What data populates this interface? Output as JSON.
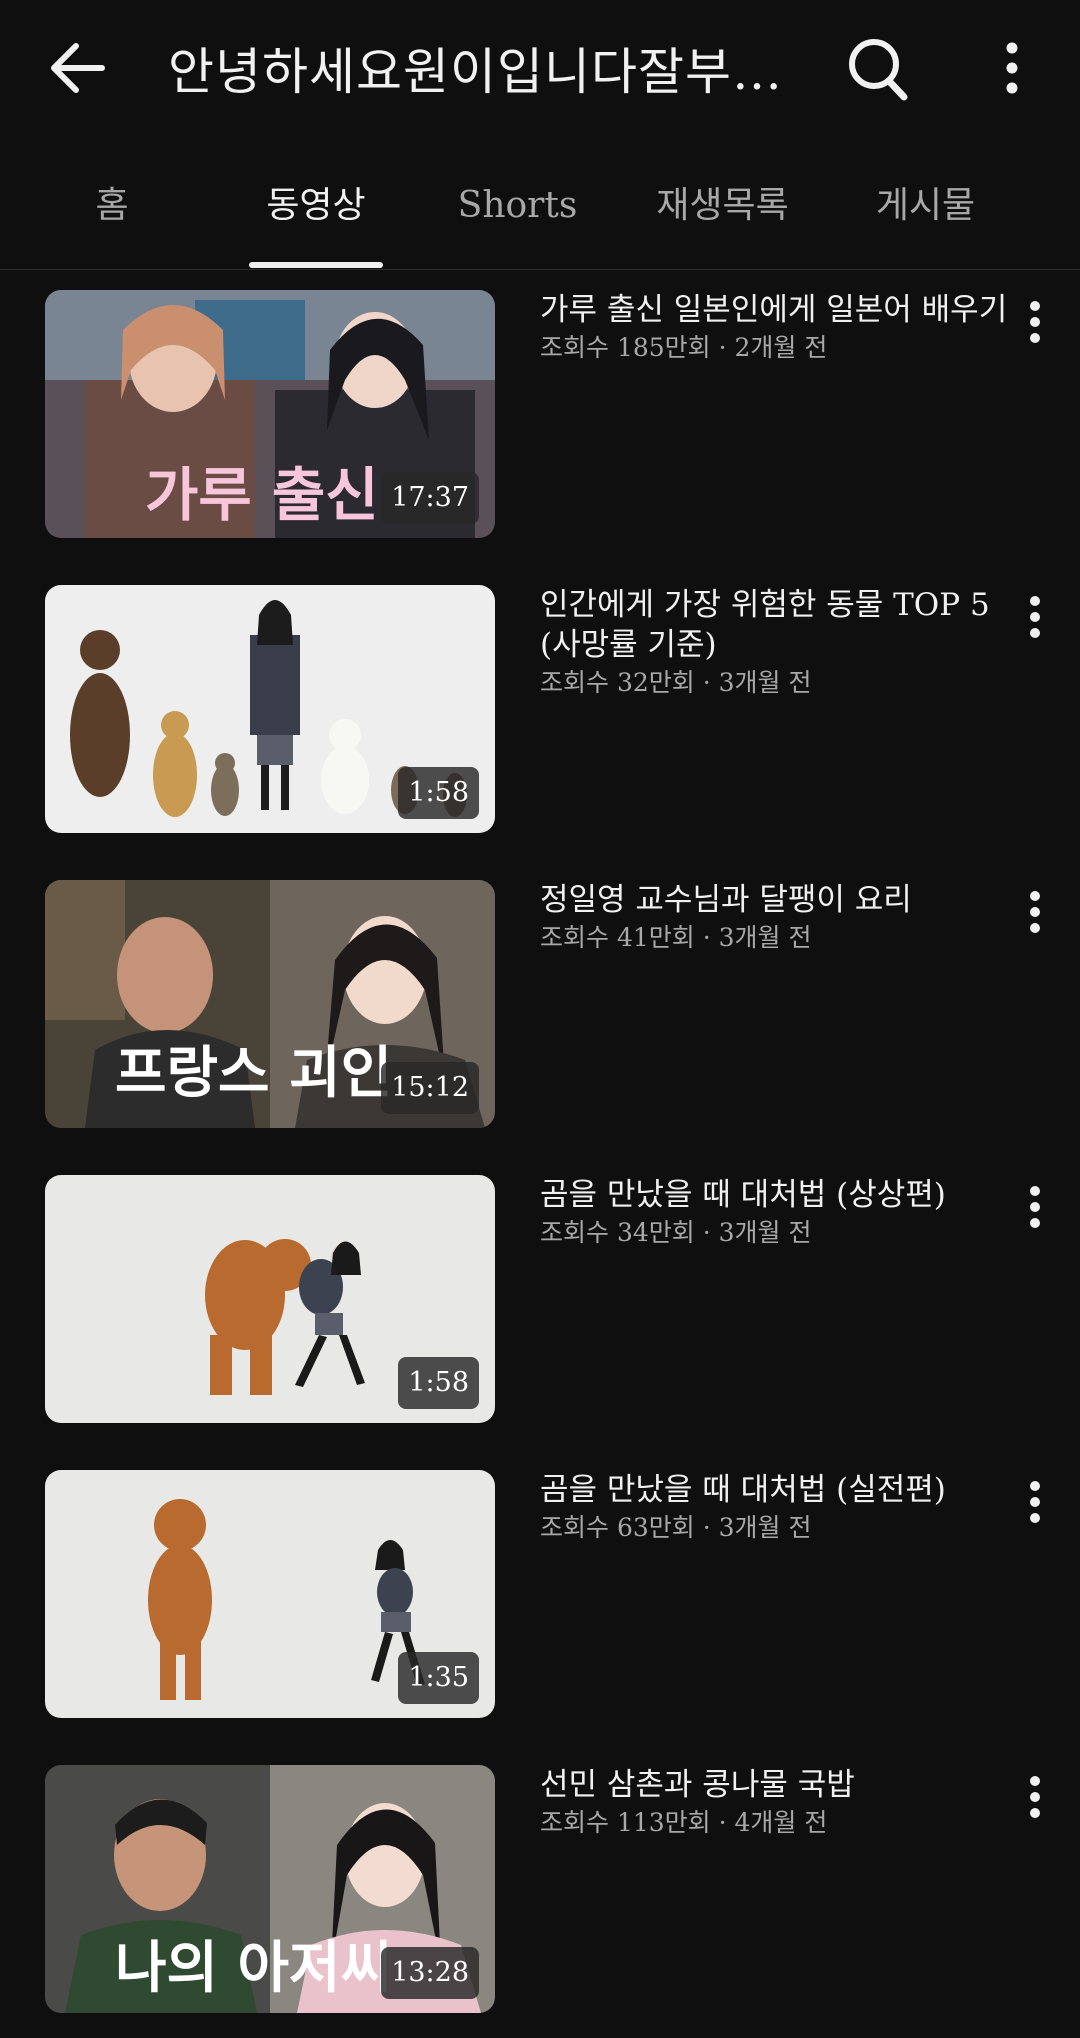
{
  "header": {
    "title": "안녕하세요원이입니다잘부탁드립니다",
    "back_icon": "arrow-left-icon",
    "search_icon": "search-icon",
    "more_icon": "more-vertical-icon"
  },
  "tabs": [
    {
      "label": "홈"
    },
    {
      "label": "동영상"
    },
    {
      "label": "Shorts"
    },
    {
      "label": "재생목록"
    },
    {
      "label": "게시물"
    }
  ],
  "active_tab": "동영상",
  "videos": [
    {
      "title": "가루 출신 일본인에게 일본어 배우기",
      "meta": "조회수 185만회 · 2개월 전",
      "duration": "17:37",
      "thumb_caption": "가루 출신"
    },
    {
      "title": "인간에게 가장 위험한 동물 TOP 5 (사망률 기준)",
      "meta": "조회수 32만회 · 3개월 전",
      "duration": "1:58"
    },
    {
      "title": "정일영 교수님과 달팽이 요리",
      "meta": "조회수 41만회 · 3개월 전",
      "duration": "15:12",
      "thumb_caption": "프랑스 괴인"
    },
    {
      "title": "곰을 만났을 때 대처법 (상상편)",
      "meta": "조회수 34만회 · 3개월 전",
      "duration": "1:58"
    },
    {
      "title": "곰을 만났을 때 대처법 (실전편)",
      "meta": "조회수 63만회 · 3개월 전",
      "duration": "1:35"
    },
    {
      "title": "선민 삼촌과 콩나물 국밥",
      "meta": "조회수 113만회 · 4개월 전",
      "duration": "13:28",
      "thumb_caption": "나의 아저씨"
    }
  ]
}
